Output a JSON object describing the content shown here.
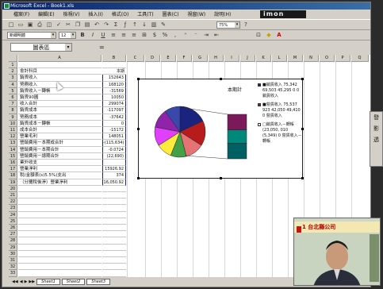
{
  "window": {
    "title": "Microsoft Excel - Book1.xls"
  },
  "menu": [
    "檔案(F)",
    "編輯(E)",
    "檢視(V)",
    "插入(I)",
    "格式(O)",
    "工具(T)",
    "圖表(C)",
    "視窗(W)",
    "說明(H)"
  ],
  "brand": "imon",
  "toolbar2": {
    "font": "新細明體",
    "size": "12",
    "zoom": "75%"
  },
  "formula_bar": {
    "name_box": "圖表區",
    "eq": "="
  },
  "columns": [
    "A",
    "B",
    "C",
    "D",
    "E",
    "F",
    "G",
    "H",
    "I",
    "J",
    "K",
    "L",
    "M",
    "N",
    "O",
    "P",
    "Q"
  ],
  "rows": [
    {
      "num": "1",
      "a": "",
      "b": ""
    },
    {
      "num": "2",
      "a": "會計科目",
      "b": "本期"
    },
    {
      "num": "3",
      "a": "銷貨收入",
      "b": "152643"
    },
    {
      "num": "4",
      "a": "勞務收入",
      "b": "168120"
    },
    {
      "num": "5",
      "a": "銷貨收入－轉帳",
      "b": "-31569"
    },
    {
      "num": "6",
      "a": "銷貨90圓",
      "b": "10050"
    },
    {
      "num": "7",
      "a": "收入合計",
      "b": "299074"
    },
    {
      "num": "8",
      "a": "銷貨成本",
      "b": "-117097"
    },
    {
      "num": "9",
      "a": "勞務成本",
      "b": "-37642"
    },
    {
      "num": "10",
      "a": "銷貨成本－轉帳",
      "b": "0"
    },
    {
      "num": "11",
      "a": "成本合計",
      "b": "-15172"
    },
    {
      "num": "12",
      "a": "營業毛利",
      "b": "148051"
    },
    {
      "num": "13",
      "a": "營銷費用－本期成合計",
      "b": "-(115,634)"
    },
    {
      "num": "14",
      "a": "營銷費用－本期合計",
      "b": "-0.0724"
    },
    {
      "num": "15",
      "a": "營銷費用－總期合計",
      "b": "(22,690)"
    },
    {
      "num": "16",
      "a": "業外收支",
      "b": ""
    },
    {
      "num": "17",
      "a": "營業淨利",
      "b": "15926.92"
    },
    {
      "num": "18",
      "a": "稅(金額表(s)5.5%)支出",
      "b": "374"
    },
    {
      "num": "19",
      "a": "（分攤稅後淨）營業淨利",
      "b": "16,050.92"
    },
    {
      "num": "20",
      "a": "",
      "b": ""
    },
    {
      "num": "21",
      "a": "",
      "b": ""
    },
    {
      "num": "22",
      "a": "",
      "b": ""
    },
    {
      "num": "23",
      "a": "",
      "b": ""
    },
    {
      "num": "24",
      "a": "",
      "b": ""
    },
    {
      "num": "25",
      "a": "",
      "b": ""
    },
    {
      "num": "26",
      "a": "",
      "b": ""
    },
    {
      "num": "27",
      "a": "",
      "b": ""
    },
    {
      "num": "28",
      "a": "",
      "b": ""
    },
    {
      "num": "29",
      "a": "",
      "b": ""
    },
    {
      "num": "30",
      "a": "",
      "b": ""
    },
    {
      "num": "31",
      "a": "",
      "b": ""
    },
    {
      "num": "32",
      "a": "",
      "b": ""
    },
    {
      "num": "33",
      "a": "",
      "b": ""
    }
  ],
  "chart": {
    "title": "本期計",
    "legend": [
      {
        "label": "■銷貨收入 75,342 69,503 45,295 0 0 銷貨收入",
        "color": "#1a237e"
      },
      {
        "label": "■營貨收入 75,537 923 42,050 49,410 0 營貨收入",
        "color": "#7a1a5a"
      },
      {
        "label": "□銷貨收入－轉帳 (23,050, 010 (5,349) 0 營貨收入－轉帳",
        "color": "#ffffff"
      }
    ],
    "slices": [
      {
        "frac": 0.18,
        "color": "#1a237e"
      },
      {
        "frac": 0.16,
        "color": "#b71c1c"
      },
      {
        "frac": 0.12,
        "color": "#e57373"
      },
      {
        "frac": 0.1,
        "color": "#43a047"
      },
      {
        "frac": 0.1,
        "color": "#ffeb3b"
      },
      {
        "frac": 0.12,
        "color": "#e040fb"
      },
      {
        "frac": 0.12,
        "color": "#8e24aa"
      },
      {
        "frac": 0.1,
        "color": "#3949ab"
      }
    ],
    "bar": [
      {
        "frac": 0.35,
        "color": "#7a1a5a"
      },
      {
        "frac": 0.3,
        "color": "#00897b"
      },
      {
        "frac": 0.35,
        "color": "#006064"
      }
    ]
  },
  "sheets": [
    "Sheet1",
    "Sheet2",
    "Sheet3"
  ],
  "right_panel": [
    "發",
    "影",
    "透"
  ],
  "video": {
    "banner": "1 台北縣公司"
  }
}
